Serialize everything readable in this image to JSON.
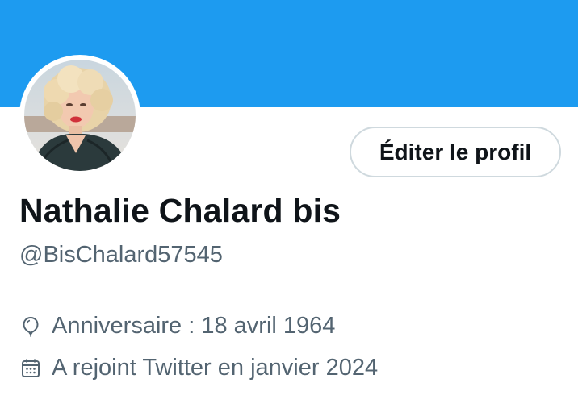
{
  "colors": {
    "banner": "#1d9bf0",
    "name": "#0f1419",
    "secondary_text": "#536471",
    "button_border": "#cfd9de"
  },
  "profile": {
    "display_name": "Nathalie Chalard bis",
    "handle": "@BisChalard57545",
    "edit_button_label": "Éditer le profil",
    "avatar_icon": "profile-photo",
    "details": {
      "birthday": {
        "icon": "balloon-icon",
        "text": "Anniversaire : 18 avril 1964"
      },
      "joined": {
        "icon": "calendar-icon",
        "text": "A rejoint Twitter en janvier 2024"
      }
    }
  }
}
